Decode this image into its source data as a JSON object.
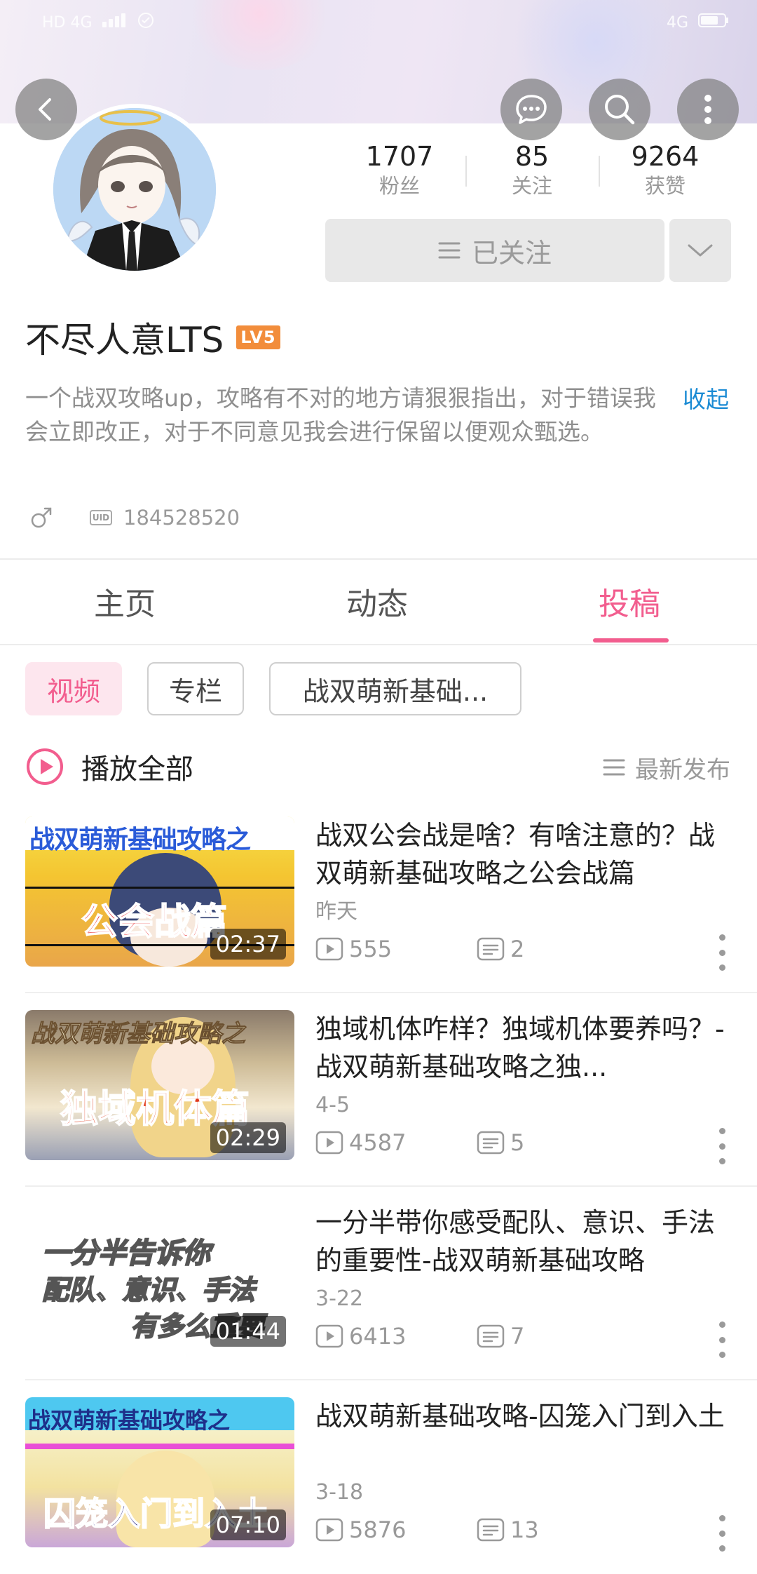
{
  "status_bar": {
    "left": "HD 4G",
    "right": "4G"
  },
  "header": {
    "back_icon": "chevron-left-icon",
    "message_icon": "chat-bubble-icon",
    "search_icon": "search-icon",
    "more_icon": "more-vertical-icon"
  },
  "profile": {
    "name": "不尽人意LTS",
    "level": "LV5",
    "bio": "一个战双攻略up，攻略有不对的地方请狠狠指出，对于错误我会立即改正，对于不同意见我会进行保留以便观众甄选。",
    "collapse_label": "收起",
    "gender_icon": "male-icon",
    "uid_badge": "UID",
    "uid": "184528520"
  },
  "stats": [
    {
      "value": "1707",
      "label": "粉丝"
    },
    {
      "value": "85",
      "label": "关注"
    },
    {
      "value": "9264",
      "label": "获赞"
    }
  ],
  "follow_button": {
    "label": "已关注"
  },
  "tabs": [
    {
      "label": "主页",
      "active": false
    },
    {
      "label": "动态",
      "active": false
    },
    {
      "label": "投稿",
      "active": true
    }
  ],
  "filters": [
    {
      "label": "视频",
      "active": true
    },
    {
      "label": "专栏",
      "active": false
    },
    {
      "label": "战双萌新基础...",
      "active": false
    }
  ],
  "play_all_label": "播放全部",
  "sort_label": "最新发布",
  "videos": [
    {
      "title": "战双公会战是啥？有啥注意的？战双萌新基础攻略之公会战篇",
      "date": "昨天",
      "views": "555",
      "comments": "2",
      "duration": "02:37",
      "thumb_line1": "战双萌新基础攻略之",
      "thumb_line2": "公会战篇"
    },
    {
      "title": "独域机体咋样？独域机体要养吗？-战双萌新基础攻略之独...",
      "date": "4-5",
      "views": "4587",
      "comments": "5",
      "duration": "02:29",
      "thumb_line1": "战双萌新基础攻略之",
      "thumb_line2": "独域机体篇"
    },
    {
      "title": "一分半带你感受配队、意识、手法的重要性-战双萌新基础攻略",
      "date": "3-22",
      "views": "6413",
      "comments": "7",
      "duration": "01:44",
      "thumb_line1": "一分半告诉你",
      "thumb_line2": "配队、意识、手法",
      "thumb_line3": "有多么重要"
    },
    {
      "title": "战双萌新基础攻略-囚笼入门到入土",
      "date": "3-18",
      "views": "5876",
      "comments": "13",
      "duration": "07:10",
      "thumb_line1": "战双萌新基础攻略之",
      "thumb_line2": "囚笼入门到入土"
    }
  ],
  "colors": {
    "accent_pink": "#f25d8e",
    "link_blue": "#1b8bd4",
    "level_orange": "#f28d3b"
  }
}
